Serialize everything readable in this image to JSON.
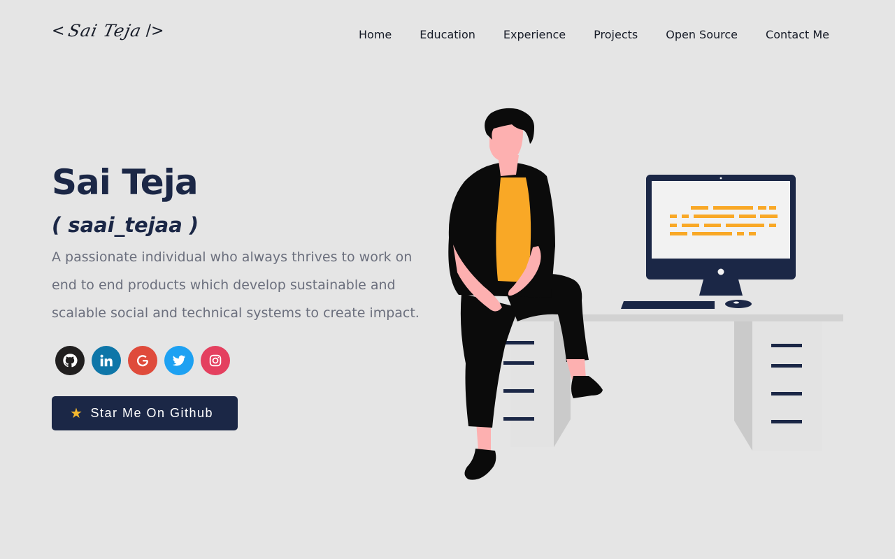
{
  "header": {
    "logo_open": "<",
    "logo_signature": "Sai Teja",
    "logo_close": "/>",
    "nav": [
      "Home",
      "Education",
      "Experience",
      "Projects",
      "Open Source",
      "Contact Me"
    ]
  },
  "hero": {
    "name": "Sai Teja",
    "handle": "( saai_tejaa )",
    "description": "A passionate individual who always thrives to work on end to end products which develop sustainable and scalable social and technical systems to create impact.",
    "social": [
      {
        "name": "github",
        "color": "#211f1f"
      },
      {
        "name": "linkedin",
        "color": "#0e76a8"
      },
      {
        "name": "google",
        "color": "#ea4335"
      },
      {
        "name": "twitter",
        "color": "#1da1f2"
      },
      {
        "name": "instagram",
        "color": "#e4405f"
      }
    ],
    "cta_icon": "★",
    "cta_label": "Star Me On Github"
  },
  "colors": {
    "background": "#e5e5e5",
    "primary": "#1b2746",
    "accent": "#f9a826",
    "text_muted": "#6b6f7d"
  }
}
